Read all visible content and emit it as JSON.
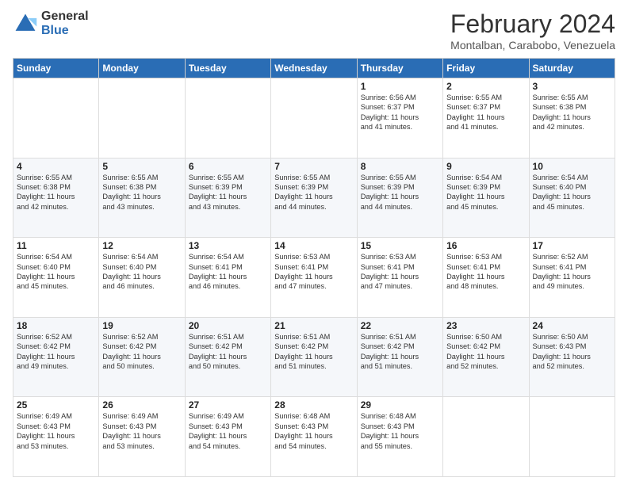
{
  "logo": {
    "general": "General",
    "blue": "Blue"
  },
  "title": "February 2024",
  "subtitle": "Montalban, Carabobo, Venezuela",
  "headers": [
    "Sunday",
    "Monday",
    "Tuesday",
    "Wednesday",
    "Thursday",
    "Friday",
    "Saturday"
  ],
  "weeks": [
    [
      {
        "num": "",
        "info": ""
      },
      {
        "num": "",
        "info": ""
      },
      {
        "num": "",
        "info": ""
      },
      {
        "num": "",
        "info": ""
      },
      {
        "num": "1",
        "info": "Sunrise: 6:56 AM\nSunset: 6:37 PM\nDaylight: 11 hours\nand 41 minutes."
      },
      {
        "num": "2",
        "info": "Sunrise: 6:55 AM\nSunset: 6:37 PM\nDaylight: 11 hours\nand 41 minutes."
      },
      {
        "num": "3",
        "info": "Sunrise: 6:55 AM\nSunset: 6:38 PM\nDaylight: 11 hours\nand 42 minutes."
      }
    ],
    [
      {
        "num": "4",
        "info": "Sunrise: 6:55 AM\nSunset: 6:38 PM\nDaylight: 11 hours\nand 42 minutes."
      },
      {
        "num": "5",
        "info": "Sunrise: 6:55 AM\nSunset: 6:38 PM\nDaylight: 11 hours\nand 43 minutes."
      },
      {
        "num": "6",
        "info": "Sunrise: 6:55 AM\nSunset: 6:39 PM\nDaylight: 11 hours\nand 43 minutes."
      },
      {
        "num": "7",
        "info": "Sunrise: 6:55 AM\nSunset: 6:39 PM\nDaylight: 11 hours\nand 44 minutes."
      },
      {
        "num": "8",
        "info": "Sunrise: 6:55 AM\nSunset: 6:39 PM\nDaylight: 11 hours\nand 44 minutes."
      },
      {
        "num": "9",
        "info": "Sunrise: 6:54 AM\nSunset: 6:39 PM\nDaylight: 11 hours\nand 45 minutes."
      },
      {
        "num": "10",
        "info": "Sunrise: 6:54 AM\nSunset: 6:40 PM\nDaylight: 11 hours\nand 45 minutes."
      }
    ],
    [
      {
        "num": "11",
        "info": "Sunrise: 6:54 AM\nSunset: 6:40 PM\nDaylight: 11 hours\nand 45 minutes."
      },
      {
        "num": "12",
        "info": "Sunrise: 6:54 AM\nSunset: 6:40 PM\nDaylight: 11 hours\nand 46 minutes."
      },
      {
        "num": "13",
        "info": "Sunrise: 6:54 AM\nSunset: 6:41 PM\nDaylight: 11 hours\nand 46 minutes."
      },
      {
        "num": "14",
        "info": "Sunrise: 6:53 AM\nSunset: 6:41 PM\nDaylight: 11 hours\nand 47 minutes."
      },
      {
        "num": "15",
        "info": "Sunrise: 6:53 AM\nSunset: 6:41 PM\nDaylight: 11 hours\nand 47 minutes."
      },
      {
        "num": "16",
        "info": "Sunrise: 6:53 AM\nSunset: 6:41 PM\nDaylight: 11 hours\nand 48 minutes."
      },
      {
        "num": "17",
        "info": "Sunrise: 6:52 AM\nSunset: 6:41 PM\nDaylight: 11 hours\nand 49 minutes."
      }
    ],
    [
      {
        "num": "18",
        "info": "Sunrise: 6:52 AM\nSunset: 6:42 PM\nDaylight: 11 hours\nand 49 minutes."
      },
      {
        "num": "19",
        "info": "Sunrise: 6:52 AM\nSunset: 6:42 PM\nDaylight: 11 hours\nand 50 minutes."
      },
      {
        "num": "20",
        "info": "Sunrise: 6:51 AM\nSunset: 6:42 PM\nDaylight: 11 hours\nand 50 minutes."
      },
      {
        "num": "21",
        "info": "Sunrise: 6:51 AM\nSunset: 6:42 PM\nDaylight: 11 hours\nand 51 minutes."
      },
      {
        "num": "22",
        "info": "Sunrise: 6:51 AM\nSunset: 6:42 PM\nDaylight: 11 hours\nand 51 minutes."
      },
      {
        "num": "23",
        "info": "Sunrise: 6:50 AM\nSunset: 6:42 PM\nDaylight: 11 hours\nand 52 minutes."
      },
      {
        "num": "24",
        "info": "Sunrise: 6:50 AM\nSunset: 6:43 PM\nDaylight: 11 hours\nand 52 minutes."
      }
    ],
    [
      {
        "num": "25",
        "info": "Sunrise: 6:49 AM\nSunset: 6:43 PM\nDaylight: 11 hours\nand 53 minutes."
      },
      {
        "num": "26",
        "info": "Sunrise: 6:49 AM\nSunset: 6:43 PM\nDaylight: 11 hours\nand 53 minutes."
      },
      {
        "num": "27",
        "info": "Sunrise: 6:49 AM\nSunset: 6:43 PM\nDaylight: 11 hours\nand 54 minutes."
      },
      {
        "num": "28",
        "info": "Sunrise: 6:48 AM\nSunset: 6:43 PM\nDaylight: 11 hours\nand 54 minutes."
      },
      {
        "num": "29",
        "info": "Sunrise: 6:48 AM\nSunset: 6:43 PM\nDaylight: 11 hours\nand 55 minutes."
      },
      {
        "num": "",
        "info": ""
      },
      {
        "num": "",
        "info": ""
      }
    ]
  ]
}
